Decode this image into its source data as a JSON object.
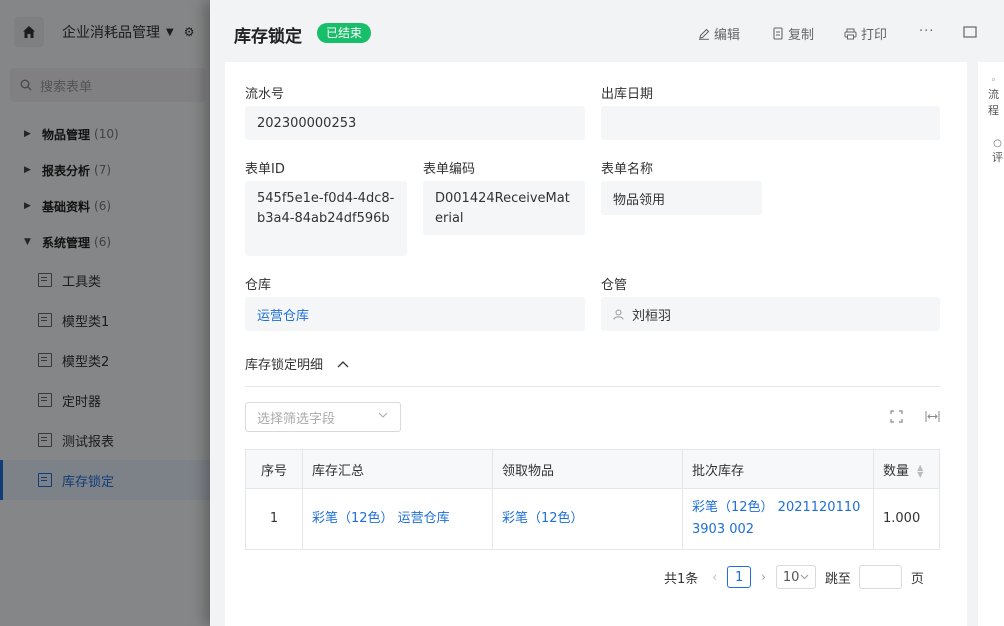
{
  "app": {
    "title": "企业消耗品管理",
    "search_placeholder": "搜索表单",
    "groups": [
      {
        "label": "物品管理",
        "count": "(10)"
      },
      {
        "label": "报表分析",
        "count": "(7)"
      },
      {
        "label": "基础资料",
        "count": "(6)"
      },
      {
        "label": "系统管理",
        "count": "(6)"
      }
    ],
    "items": [
      "工具类",
      "模型类1",
      "模型类2",
      "定时器",
      "测试报表",
      "库存锁定"
    ],
    "active_item": "库存锁定"
  },
  "drawer": {
    "title": "库存锁定",
    "status": "已结束",
    "actions": {
      "edit": "编辑",
      "copy": "复制",
      "print": "打印",
      "more": "···"
    },
    "side": {
      "flow": "流程",
      "comment": "评"
    }
  },
  "form": {
    "serial_label": "流水号",
    "serial_value": "202300000253",
    "out_date_label": "出库日期",
    "out_date_value": "",
    "form_id_label": "表单ID",
    "form_id_value": "545f5e1e-f0d4-4dc8-b3a4-84ab24df596b",
    "form_code_label": "表单编码",
    "form_code_value": "D001424ReceiveMaterial",
    "form_name_label": "表单名称",
    "form_name_value": "物品领用",
    "warehouse_label": "仓库",
    "warehouse_value": "运营仓库",
    "keeper_label": "仓管",
    "keeper_value": "刘桓羽"
  },
  "detail": {
    "section_title": "库存锁定明细",
    "filter_placeholder": "选择筛选字段",
    "columns": [
      "序号",
      "库存汇总",
      "领取物品",
      "批次库存",
      "数量"
    ],
    "rows": [
      {
        "no": "1",
        "summary": "彩笔（12色） 运营仓库",
        "item": "彩笔（12色）",
        "batch": "彩笔（12色） 20211201103903 002",
        "qty": "1.000"
      }
    ]
  },
  "pager": {
    "total": "共1条",
    "page": "1",
    "page_size": "10",
    "goto_label": "跳至",
    "page_unit": "页"
  },
  "colors": {
    "accent": "#1e6fd9",
    "status_green": "#19be6b"
  }
}
